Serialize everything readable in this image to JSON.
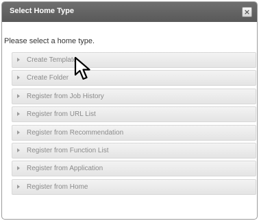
{
  "dialog": {
    "title": "Select Home Type",
    "close_label": "×",
    "instruction": "Please select a home type."
  },
  "home_types": [
    {
      "label": "Create Template"
    },
    {
      "label": "Create Folder"
    },
    {
      "label": "Register from Job History"
    },
    {
      "label": "Register from URL List"
    },
    {
      "label": "Register from Recommendation"
    },
    {
      "label": "Register from Function List"
    },
    {
      "label": "Register from Application"
    },
    {
      "label": "Register from Home"
    }
  ]
}
